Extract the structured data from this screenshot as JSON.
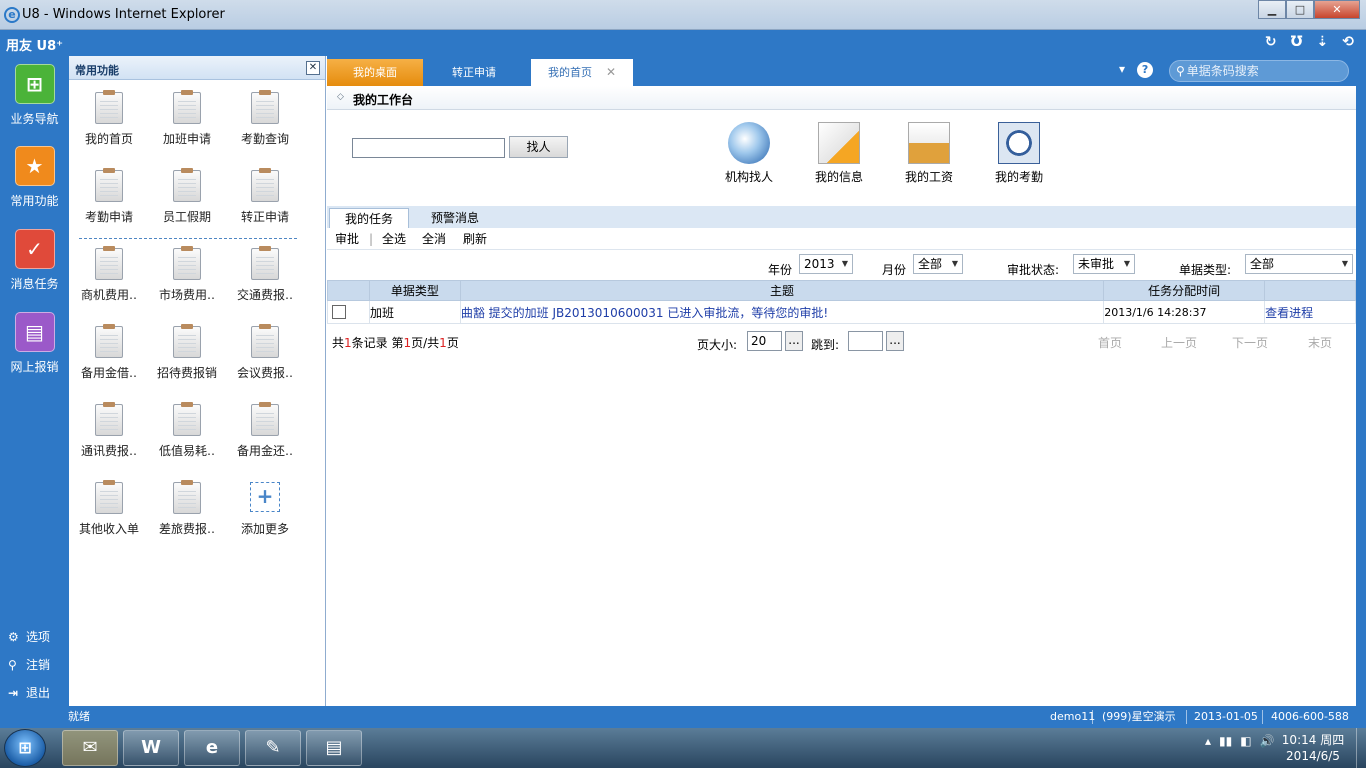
{
  "window": {
    "title": "U8 - Windows Internet Explorer",
    "buttons": {
      "minimize": "▁",
      "maximize": "□",
      "close": "✕"
    }
  },
  "app": {
    "brand": "用友 U8⁺",
    "top_icons": [
      "↻",
      "Ʊ",
      "⇣",
      "⟲"
    ]
  },
  "leftnav": {
    "items": [
      {
        "label": "业务导航",
        "icon": "navigation-icon",
        "color": "#4bb339"
      },
      {
        "label": "常用功能",
        "icon": "favorite-star-icon",
        "color": "#f08a1c"
      },
      {
        "label": "消息任务",
        "icon": "message-task-icon",
        "color": "#e04a3a"
      },
      {
        "label": "网上报销",
        "icon": "reimbursement-icon",
        "color": "#9b59c9"
      }
    ],
    "bottom": [
      {
        "label": "选项",
        "icon": "⚙"
      },
      {
        "label": "注销",
        "icon": "⚲"
      },
      {
        "label": "退出",
        "icon": "⇥"
      }
    ]
  },
  "common_panel": {
    "title": "常用功能",
    "close": "✕",
    "items": [
      "我的首页",
      "加班申请",
      "考勤查询",
      "考勤申请",
      "员工假期",
      "转正申请",
      "商机费用‥",
      "市场费用‥",
      "交通费报‥",
      "备用金借‥",
      "招待费报销",
      "会议费报‥",
      "通讯费报‥",
      "低值易耗‥",
      "备用金还‥",
      "其他收入单",
      "差旅费报‥"
    ],
    "add_more": "添加更多",
    "add_icon": "+"
  },
  "tabs": [
    {
      "label": "我的桌面"
    },
    {
      "label": "转正申请"
    },
    {
      "label": "我的首页",
      "close": "✕"
    }
  ],
  "tabbar": {
    "dropdown_icon": "▾",
    "help_icon": "?",
    "search_placeholder": "单据条码搜索",
    "search_icon": "⚲"
  },
  "workbench": {
    "title": "我的工作台",
    "find_button": "找人",
    "find_value": "",
    "quick_links": [
      "机构找人",
      "我的信息",
      "我的工资",
      "我的考勤"
    ]
  },
  "tasks": {
    "tabs": [
      "我的任务",
      "预警消息"
    ],
    "actions": [
      "审批",
      "全选",
      "全消",
      "刷新"
    ],
    "filters": {
      "year_label": "年份",
      "year_value": "2013",
      "month_label": "月份",
      "month_value": "全部",
      "status_label": "审批状态:",
      "status_value": "未审批",
      "doctype_label": "单据类型:",
      "doctype_value": "全部"
    },
    "columns": [
      "单据类型",
      "主题",
      "任务分配时间"
    ],
    "rows": [
      {
        "type": "加班",
        "subject": "曲豁  提交的加班  JB2013010600031 已进入审批流，等待您的审批!",
        "time": "2013/1/6 14:28:37",
        "action": "查看进程"
      }
    ],
    "pager": {
      "total_prefix": "共",
      "total_count": "1",
      "total_suffix": "条记录 第",
      "page": "1",
      "page_mid": "页/共",
      "pages": "1",
      "page_suffix": "页",
      "size_label": "页大小:",
      "size_value": "20",
      "jump_label": "跳到:",
      "jump_value": "",
      "btn": "...",
      "first": "首页",
      "prev": "上一页",
      "next": "下一页",
      "last": "末页"
    }
  },
  "statusbar": {
    "ready": "就绪",
    "user": "demo11",
    "account": "(999)星空演示",
    "date": "2013-01-05",
    "phone": "4006-600-588"
  },
  "taskbar": {
    "start": "⊞",
    "apps": [
      {
        "name": "outlook-icon",
        "glyph": "✉"
      },
      {
        "name": "word-icon",
        "glyph": "W"
      },
      {
        "name": "ie-icon",
        "glyph": "e"
      },
      {
        "name": "paint-icon",
        "glyph": "✎"
      },
      {
        "name": "explorer-icon",
        "glyph": "▤"
      }
    ],
    "tray": [
      "▴",
      "▮▮",
      "◧",
      "🔊"
    ],
    "time": "10:14 周四",
    "date": "2014/6/5"
  }
}
